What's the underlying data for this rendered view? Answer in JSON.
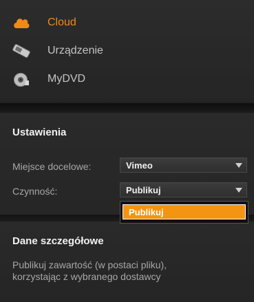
{
  "destinations": {
    "items": [
      {
        "label": "Cloud",
        "icon": "cloud-icon",
        "active": true
      },
      {
        "label": "Urządzenie",
        "icon": "device-icon",
        "active": false
      },
      {
        "label": "MyDVD",
        "icon": "disc-icon",
        "active": false
      }
    ]
  },
  "settings": {
    "title": "Ustawienia",
    "destination_label": "Miejsce docelowe:",
    "destination_value": "Vimeo",
    "action_label": "Czynność:",
    "action_value": "Publikuj",
    "action_options": [
      "Publikuj"
    ]
  },
  "details": {
    "title": "Dane szczegółowe",
    "description_line1": "Publikuj zawartość (w postaci pliku),",
    "description_line2": "korzystając z wybranego dostawcy"
  },
  "colors": {
    "accent": "#f08a14",
    "panel": "#2a2a2a",
    "separator": "#141414"
  }
}
